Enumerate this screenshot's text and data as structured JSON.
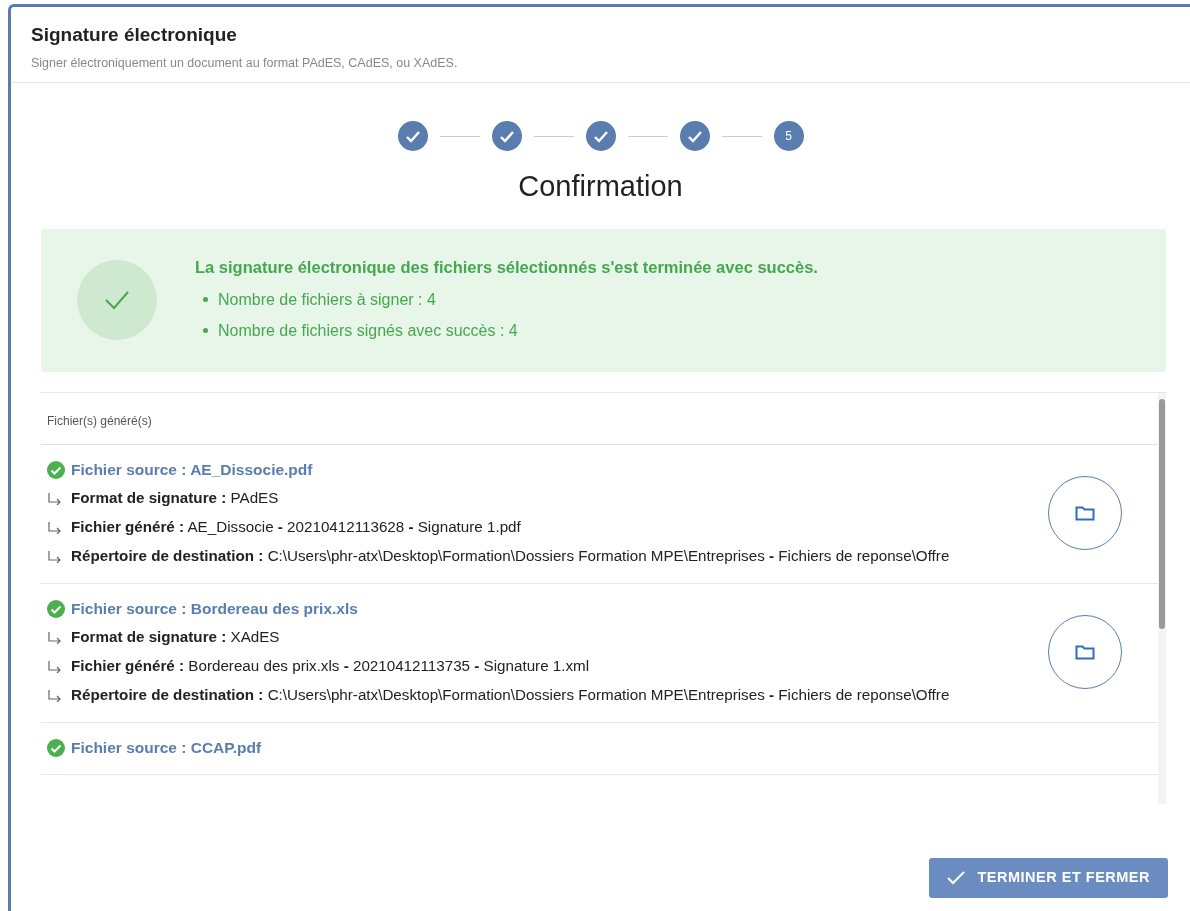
{
  "dialog": {
    "title": "Signature électronique",
    "subtitle": "Signer électroniquement un document au format PAdES, CAdES, ou XAdES."
  },
  "steps": [
    {
      "completed": true
    },
    {
      "completed": true
    },
    {
      "completed": true
    },
    {
      "completed": true
    },
    {
      "completed": false,
      "label": "5"
    }
  ],
  "step_title": "Confirmation",
  "alert": {
    "heading": "La signature électronique des fichiers sélectionnés s'est terminée avec succès.",
    "items": [
      "Nombre de fichiers à signer : 4",
      "Nombre de fichiers signés avec succès : 4"
    ]
  },
  "files_panel": {
    "header": "Fichier(s) généré(s)",
    "files": [
      {
        "source": "Fichier source : AE_Dissocie.pdf",
        "success": true,
        "details": [
          "**Format de signature :** PAdES",
          "**Fichier généré :** AE_Dissocie **-** 20210412113628 **-** Signature 1.pdf",
          "**Répertoire de destination :** C:\\Users\\phr-atx\\Desktop\\Formation\\Dossiers Formation MPE\\Entreprises **-** Fichiers de reponse\\Offre"
        ]
      },
      {
        "source": "Fichier source : Bordereau des prix.xls",
        "success": true,
        "details": [
          "**Format de signature :** XAdES",
          "**Fichier généré :** Bordereau des prix.xls **-** 20210412113735 **-** Signature 1.xml",
          "**Répertoire de destination :** C:\\Users\\phr-atx\\Desktop\\Formation\\Dossiers Formation MPE\\Entreprises **-** Fichiers de reponse\\Offre"
        ]
      },
      {
        "source": "Fichier source : CCAP.pdf",
        "success": true
      }
    ]
  },
  "finish_button": "TERMINER ET FERMER"
}
